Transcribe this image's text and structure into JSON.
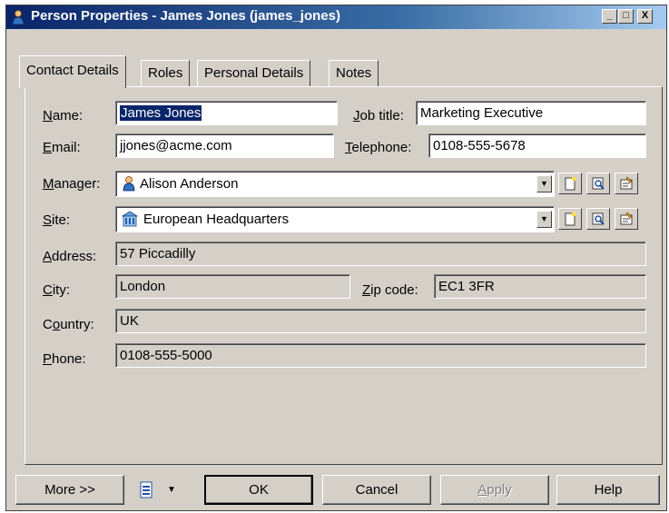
{
  "window": {
    "title": "Person Properties - James Jones (james_jones)",
    "controls": {
      "minimize": "_",
      "maximize": "□",
      "close": "X"
    }
  },
  "tabs": [
    {
      "label": "Contact Details",
      "active": true
    },
    {
      "label": "Roles",
      "active": false
    },
    {
      "label": "Personal Details",
      "active": false
    },
    {
      "label": "Notes",
      "active": false
    }
  ],
  "form": {
    "name": {
      "label_key": "N",
      "label_rest": "ame:",
      "value": "James Jones"
    },
    "job_title": {
      "label_key": "J",
      "label_rest": "ob title:",
      "value": "Marketing Executive"
    },
    "email": {
      "label_key": "E",
      "label_rest": "mail:",
      "value": "jjones@acme.com"
    },
    "telephone": {
      "label_key": "T",
      "label_rest": "elephone:",
      "value": "0108-555-5678"
    },
    "manager": {
      "label_key": "M",
      "label_rest": "anager:",
      "value": "Alison Anderson",
      "icon": "person-icon"
    },
    "site": {
      "label_key": "S",
      "label_rest": "ite:",
      "value": "European Headquarters",
      "icon": "building-icon"
    },
    "address": {
      "label_key": "A",
      "label_rest": "ddress:",
      "value": "57 Piccadilly"
    },
    "city": {
      "label_key": "C",
      "label_rest": "ity:",
      "value": "London"
    },
    "zip_code": {
      "label_key": "Z",
      "label_rest": "ip code:",
      "value": "EC1 3FR"
    },
    "country": {
      "label_pre": "C",
      "label_key": "o",
      "label_rest": "untry:",
      "value": "UK"
    },
    "phone": {
      "label_key": "P",
      "label_rest": "hone:",
      "value": "0108-555-5000"
    }
  },
  "buttons": {
    "more": "More >>",
    "ok": "OK",
    "cancel": "Cancel",
    "apply_key": "A",
    "apply_rest": "pply",
    "help": "Help"
  },
  "colors": {
    "titlebar_start": "#0a246a",
    "titlebar_end": "#a6caf0",
    "face": "#d4d0c8",
    "selection": "#0a246a"
  }
}
